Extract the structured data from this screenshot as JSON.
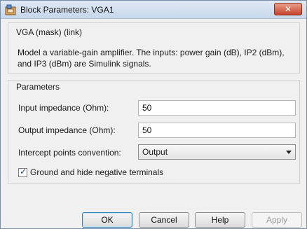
{
  "window": {
    "title": "Block Parameters: VGA1",
    "close_label": "✕"
  },
  "description_group": {
    "legend": "VGA (mask) (link)",
    "text": "Model a variable-gain amplifier. The inputs: power gain (dB), IP2 (dBm), and IP3 (dBm) are Simulink signals."
  },
  "parameters": {
    "legend": "Parameters",
    "input_impedance": {
      "label": "Input impedance (Ohm):",
      "value": "50"
    },
    "output_impedance": {
      "label": "Output impedance (Ohm):",
      "value": "50"
    },
    "intercept_convention": {
      "label": "Intercept points convention:",
      "selected": "Output"
    },
    "ground_checkbox": {
      "label": "Ground and hide negative terminals",
      "checked": true
    }
  },
  "buttons": {
    "ok": "OK",
    "cancel": "Cancel",
    "help": "Help",
    "apply": "Apply"
  }
}
